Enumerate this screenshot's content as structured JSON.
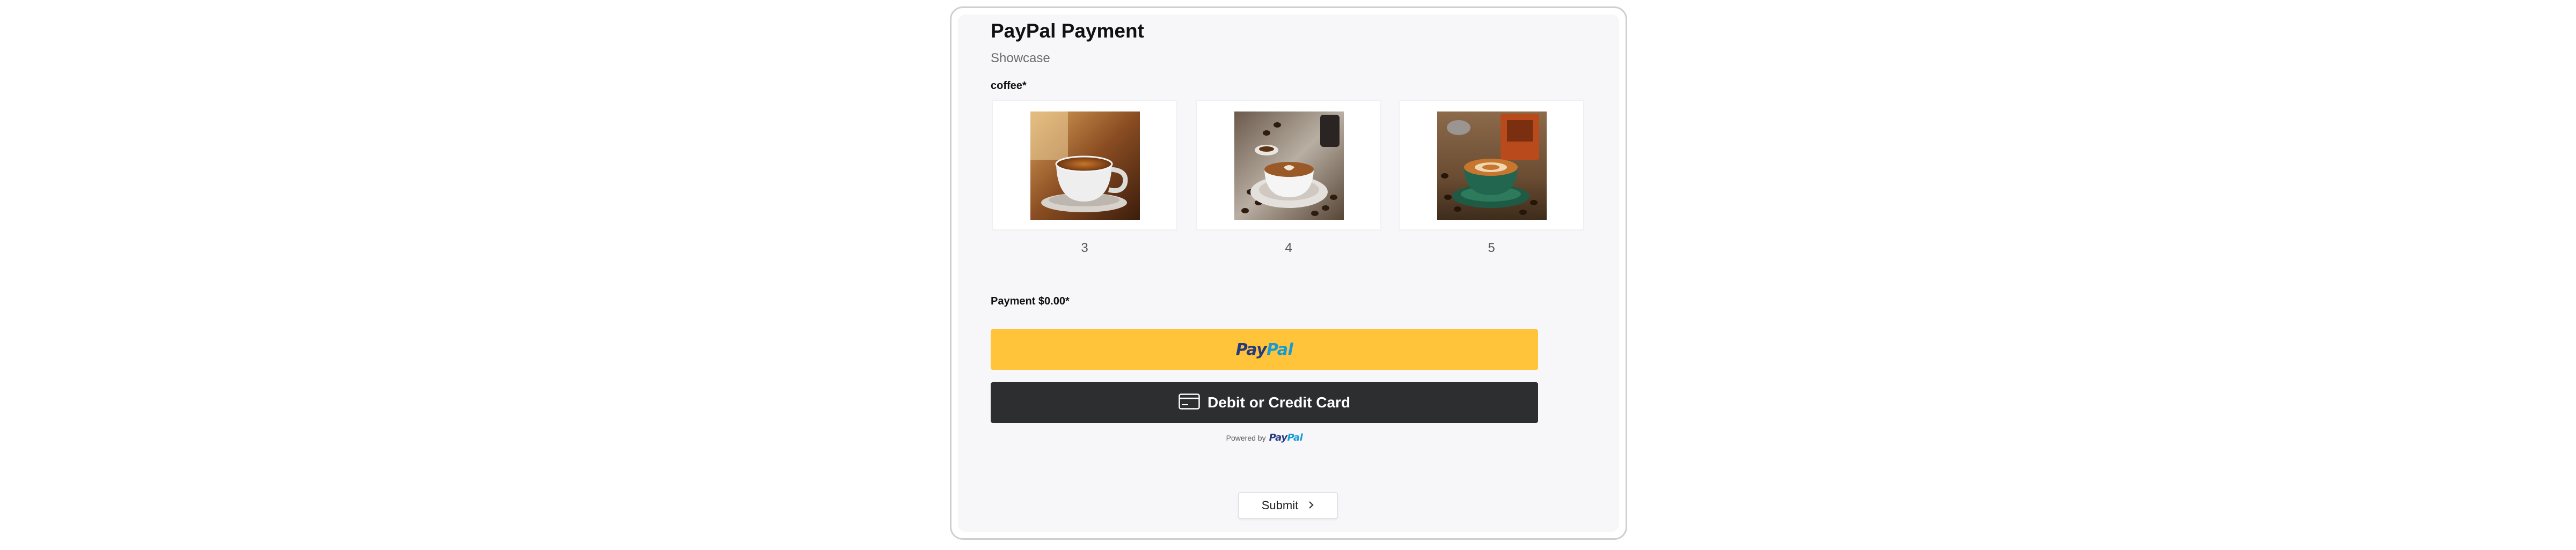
{
  "form": {
    "title": "PayPal Payment",
    "subtitle": "Showcase"
  },
  "coffee_field": {
    "label": "coffee*",
    "options": [
      {
        "value": "3",
        "image": "coffee-cup-on-wooden-table"
      },
      {
        "value": "4",
        "image": "latte-art-with-coffee-beans"
      },
      {
        "value": "5",
        "image": "latte-in-green-cup-with-grinder"
      }
    ]
  },
  "payment_field": {
    "label": "Payment $0.00*"
  },
  "paypal_button": {
    "logo_part1": "Pay",
    "logo_part2": "Pal"
  },
  "card_button": {
    "label": "Debit or Credit Card",
    "icon": "credit-card-icon"
  },
  "powered_by": {
    "text": "Powered by",
    "logo_part1": "Pay",
    "logo_part2": "Pal"
  },
  "submit": {
    "label": "Submit",
    "icon": "chevron-right-icon"
  },
  "colors": {
    "paypal_yellow": "#ffc439",
    "card_black": "#2c2e2f",
    "paypal_dark_blue": "#253b80",
    "paypal_light_blue": "#179bd7"
  }
}
